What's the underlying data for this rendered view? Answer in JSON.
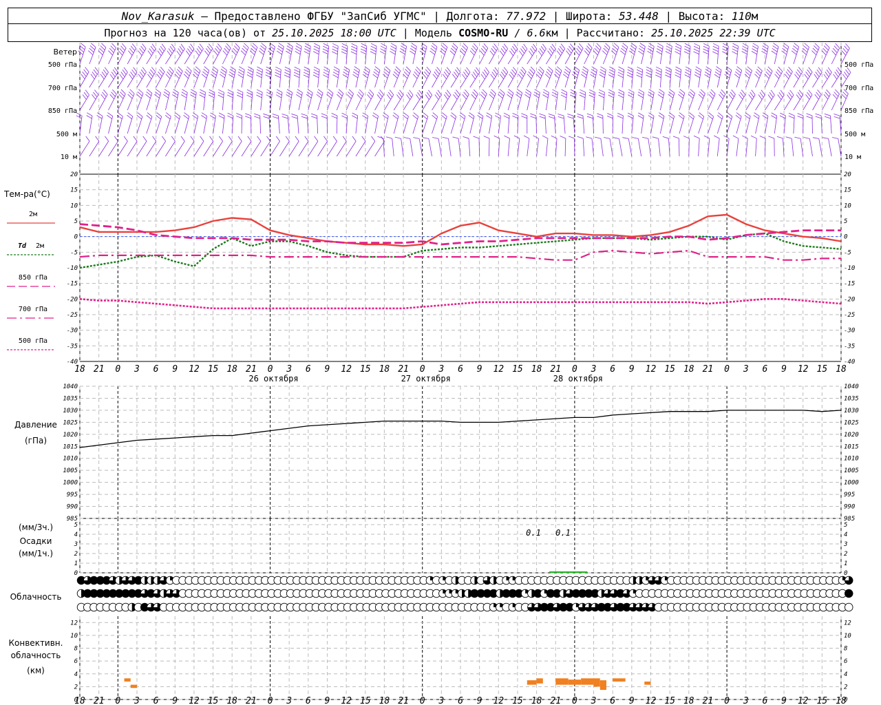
{
  "header": {
    "station": "Nov_Karasuk",
    "provider": " – Предоставлено ФГБУ \"ЗапСиб УГМС\" | Долгота: ",
    "lon": "77.972",
    "lat_label": " | Широта: ",
    "lat": "53.448",
    "alt_label": " | Высота: ",
    "alt": "110",
    "alt_unit": "м",
    "forecast_label": "Прогноз на 120 часа(ов) от ",
    "forecast_start": "25.10.2025 18:00 UTC",
    "model_label": " | Модель ",
    "model": "COSMO-RU",
    "res_sep": " / ",
    "res": "6.6",
    "res_unit": "км",
    "calc_label": " | Рассчитано: ",
    "calc_time": "25.10.2025 22:39 UTC"
  },
  "colors": {
    "t2m": "#e8413c",
    "td2m": "#1a7a1a",
    "t850": "#e0218a",
    "t700": "#e0218a",
    "t500": "#e0218a",
    "wind": "#8a2be2",
    "precip": "#22bb22",
    "conv": "#f08020",
    "pressure": "#000000"
  },
  "chart_data": [
    {
      "type": "wind_barbs",
      "panel_label": "Ветер",
      "levels": [
        "500 гПа",
        "700 гПа",
        "850 гПа",
        "500 м",
        "10 м"
      ],
      "level_speeds_approx_kt": [
        45,
        40,
        25,
        20,
        10
      ]
    },
    {
      "type": "line",
      "ylabel": "Тем-ра(°С)",
      "ylim": [
        -40,
        20
      ],
      "yticks": [
        20,
        15,
        10,
        5,
        0,
        -5,
        -10,
        -15,
        -20,
        -25,
        -30,
        -35,
        -40
      ],
      "x_hours_from_start": [
        0,
        3,
        6,
        9,
        12,
        15,
        18,
        21,
        24,
        27,
        30,
        33,
        36,
        39,
        42,
        45,
        48,
        51,
        54,
        57,
        60,
        63,
        66,
        69,
        72,
        75,
        78,
        81,
        84,
        87,
        90,
        93,
        96,
        99,
        102,
        105,
        108,
        111,
        114,
        117,
        120
      ],
      "series": [
        {
          "name": "2м",
          "style": "solid",
          "values": [
            3,
            1.5,
            1.5,
            1.5,
            1.5,
            2,
            3,
            5,
            6,
            5.5,
            2,
            0.5,
            -0.5,
            -1.5,
            -2,
            -2.5,
            -2.5,
            -3,
            -2.5,
            1,
            3.5,
            4.5,
            2,
            1,
            0,
            1,
            1,
            0.5,
            0.5,
            0,
            0.5,
            1.5,
            3.5,
            6.5,
            7,
            4,
            2,
            1,
            0,
            -0.5,
            -1.5
          ]
        },
        {
          "name": "Td 2м",
          "style": "dotted",
          "values": [
            -10,
            -9,
            -8,
            -6.5,
            -6,
            -8,
            -9.5,
            -4,
            -0.5,
            -3,
            -1.5,
            -1.5,
            -3,
            -5,
            -6,
            -6.5,
            -6.5,
            -6.5,
            -4.5,
            -4,
            -3.5,
            -3.5,
            -3,
            -2.5,
            -2,
            -1.5,
            -1,
            -0.5,
            -0.5,
            -0.5,
            -1,
            -0.5,
            0,
            0,
            -1,
            0.5,
            1,
            -1.5,
            -3,
            -3.5,
            -4
          ]
        },
        {
          "name": "850 гПа",
          "style": "dashed",
          "values": [
            4,
            3.5,
            3,
            2,
            0.5,
            0,
            -0.5,
            -0.5,
            -0.5,
            -1,
            -1,
            -1,
            -1.5,
            -1.5,
            -2,
            -2,
            -2,
            -2,
            -1.5,
            -2.5,
            -2,
            -1.5,
            -1.5,
            -1,
            -0.5,
            -0.5,
            -0.5,
            -0.5,
            -0.5,
            -0.5,
            -0.5,
            0,
            0,
            -1,
            -0.5,
            0.5,
            1,
            1.5,
            2,
            2,
            2
          ]
        },
        {
          "name": "700 гПа",
          "style": "dashdot",
          "values": [
            -6.5,
            -6,
            -6,
            -6,
            -6,
            -6,
            -6,
            -6,
            -6,
            -6,
            -6.5,
            -6.5,
            -6.5,
            -6.5,
            -6.5,
            -6.5,
            -6.5,
            -6.5,
            -6.5,
            -6.5,
            -6.5,
            -6.5,
            -6.5,
            -6.5,
            -7,
            -7.5,
            -7.5,
            -5,
            -4.5,
            -5,
            -5.5,
            -5,
            -4.5,
            -6.5,
            -6.5,
            -6.5,
            -6.5,
            -7.5,
            -7.5,
            -7,
            -7
          ]
        },
        {
          "name": "500 гПа",
          "style": "dotted",
          "values": [
            -20,
            -20.5,
            -20.5,
            -21,
            -21.5,
            -22,
            -22.5,
            -23,
            -23,
            -23,
            -23,
            -23,
            -23,
            -23,
            -23,
            -23,
            -23,
            -23,
            -22.5,
            -22,
            -21.5,
            -21,
            -21,
            -21,
            -21,
            -21,
            -21,
            -21,
            -21,
            -21,
            -21,
            -21,
            -21,
            -21.5,
            -21,
            -20.5,
            -20,
            -20,
            -20.5,
            -21,
            -21.5
          ]
        }
      ]
    },
    {
      "type": "line",
      "ylabel": "Давление",
      "yunit": "(гПа)",
      "ylim": [
        985,
        1040
      ],
      "yticks": [
        1040,
        1035,
        1030,
        1025,
        1020,
        1015,
        1010,
        1005,
        1000,
        995,
        990,
        985
      ],
      "x_hours_from_start": [
        0,
        3,
        6,
        9,
        12,
        15,
        18,
        21,
        24,
        27,
        30,
        33,
        36,
        39,
        42,
        45,
        48,
        51,
        54,
        57,
        60,
        63,
        66,
        69,
        72,
        75,
        78,
        81,
        84,
        87,
        90,
        93,
        96,
        99,
        102,
        105,
        108,
        111,
        114,
        117,
        120
      ],
      "series": [
        {
          "name": "Давление",
          "values": [
            1014.5,
            1015.5,
            1016.5,
            1017.5,
            1018,
            1018.5,
            1019,
            1019.5,
            1019.5,
            1020.5,
            1021.5,
            1022.5,
            1023.5,
            1024,
            1024.5,
            1025,
            1025.5,
            1025.5,
            1025.5,
            1025.5,
            1025,
            1025,
            1025,
            1025.5,
            1026,
            1026.5,
            1027,
            1027,
            1028,
            1028.5,
            1029,
            1029.5,
            1029.5,
            1029.5,
            1030,
            1030,
            1030,
            1030,
            1030,
            1029.5,
            1030
          ]
        }
      ]
    },
    {
      "type": "bar",
      "ylabel": "Осадки",
      "yunit_top": "(мм/3ч.)",
      "yunit_bottom": "(мм/1ч.)",
      "ylim": [
        0,
        5
      ],
      "yticks": [
        5,
        4,
        3,
        2,
        1,
        0
      ],
      "annotations": [
        "0.1",
        "0.1"
      ],
      "bars": [
        {
          "hour": 75,
          "value": 0.1
        },
        {
          "hour": 77,
          "value": 0.15
        },
        {
          "hour": 79,
          "value": 0.1
        }
      ]
    },
    {
      "type": "cloud_cover",
      "ylabel": "Облачность",
      "rows": [
        [
          8,
          6,
          8,
          8,
          8,
          6,
          4,
          6,
          6,
          8,
          4,
          4,
          4,
          6,
          2,
          0,
          0,
          0,
          0,
          0,
          0,
          0,
          0,
          0,
          0,
          0,
          0,
          0,
          0,
          0,
          0,
          0,
          0,
          0,
          0,
          0,
          0,
          0,
          0,
          0,
          0,
          0,
          0,
          0,
          0,
          0,
          0,
          0,
          0,
          0,
          0,
          0,
          0,
          0,
          0,
          2,
          0,
          2,
          0,
          4,
          0,
          0,
          4,
          0,
          6,
          4,
          0,
          2,
          2,
          0,
          0,
          0,
          0,
          0,
          0,
          0,
          0,
          0,
          0,
          0,
          0,
          0,
          0,
          0,
          0,
          0,
          0,
          4,
          4,
          2,
          6,
          6,
          2,
          0,
          0,
          0,
          0,
          0,
          0,
          0,
          0,
          0,
          0,
          0,
          0,
          0,
          0,
          0,
          0,
          0,
          0,
          0,
          0,
          0,
          0,
          0,
          0,
          0,
          0,
          0,
          2,
          6
        ],
        [
          4,
          8,
          8,
          8,
          8,
          8,
          8,
          8,
          8,
          8,
          6,
          8,
          6,
          4,
          6,
          6,
          0,
          0,
          0,
          0,
          0,
          0,
          0,
          0,
          0,
          0,
          0,
          0,
          0,
          0,
          0,
          0,
          0,
          0,
          0,
          0,
          0,
          0,
          0,
          0,
          0,
          0,
          0,
          0,
          0,
          0,
          0,
          0,
          0,
          0,
          0,
          0,
          0,
          0,
          0,
          0,
          0,
          2,
          2,
          2,
          4,
          4,
          8,
          8,
          8,
          8,
          4,
          8,
          8,
          8,
          2,
          4,
          8,
          2,
          8,
          8,
          4,
          6,
          8,
          8,
          8,
          8,
          4,
          6,
          6,
          8,
          6,
          2,
          0,
          0,
          0,
          0,
          0,
          0,
          0,
          0,
          0,
          0,
          0,
          0,
          0,
          0,
          0,
          0,
          0,
          0,
          0,
          0,
          0,
          0,
          0,
          0,
          0,
          0,
          0,
          0,
          0,
          0,
          0,
          0,
          0,
          8
        ],
        [
          0,
          0,
          0,
          0,
          0,
          0,
          0,
          0,
          4,
          0,
          8,
          6,
          6,
          0,
          0,
          0,
          0,
          0,
          0,
          0,
          0,
          0,
          0,
          0,
          0,
          0,
          0,
          0,
          0,
          0,
          0,
          0,
          0,
          0,
          0,
          0,
          0,
          0,
          0,
          0,
          0,
          0,
          0,
          0,
          0,
          0,
          0,
          0,
          0,
          0,
          0,
          0,
          0,
          0,
          0,
          0,
          0,
          0,
          0,
          0,
          0,
          0,
          0,
          0,
          0,
          2,
          2,
          0,
          2,
          0,
          0,
          6,
          6,
          8,
          8,
          6,
          8,
          8,
          2,
          6,
          6,
          6,
          8,
          8,
          6,
          8,
          8,
          6,
          6,
          6,
          6,
          0,
          0,
          0,
          0,
          0,
          0,
          0,
          0,
          0,
          0,
          0,
          0,
          0,
          0,
          0,
          0,
          0,
          0,
          0,
          0,
          0,
          0,
          0,
          0,
          0,
          0,
          0,
          0,
          0,
          0,
          0
        ]
      ]
    },
    {
      "type": "bar",
      "ylabel": "Конвективн. облачность",
      "yunit": "(км)",
      "ylim": [
        0,
        13
      ],
      "yticks": [
        12,
        10,
        8,
        6,
        4,
        2,
        0
      ],
      "segments": [
        {
          "hour_from": 7,
          "hour_to": 8,
          "bottom_km": 2.8,
          "top_km": 3.3
        },
        {
          "hour_from": 8,
          "hour_to": 9,
          "bottom_km": 1.8,
          "top_km": 2.3
        },
        {
          "hour_from": 70.5,
          "hour_to": 72,
          "bottom_km": 2.3,
          "top_km": 3
        },
        {
          "hour_from": 72,
          "hour_to": 73,
          "bottom_km": 2.5,
          "top_km": 3.3
        },
        {
          "hour_from": 75,
          "hour_to": 77,
          "bottom_km": 2.3,
          "top_km": 3.3
        },
        {
          "hour_from": 77,
          "hour_to": 79,
          "bottom_km": 2.3,
          "top_km": 3.1
        },
        {
          "hour_from": 79,
          "hour_to": 81,
          "bottom_km": 2.3,
          "top_km": 3.3
        },
        {
          "hour_from": 81,
          "hour_to": 82,
          "bottom_km": 2,
          "top_km": 3.3
        },
        {
          "hour_from": 82,
          "hour_to": 83,
          "bottom_km": 1.5,
          "top_km": 3
        },
        {
          "hour_from": 84,
          "hour_to": 86,
          "bottom_km": 2.8,
          "top_km": 3.3
        },
        {
          "hour_from": 89,
          "hour_to": 90,
          "bottom_km": 2.3,
          "top_km": 2.8
        }
      ]
    }
  ],
  "time_axis": {
    "hour_labels": [
      "18",
      "21",
      "0",
      "3",
      "6",
      "9",
      "12",
      "15",
      "18",
      "21",
      "0",
      "3",
      "6",
      "9",
      "12",
      "15",
      "18",
      "21",
      "0",
      "3",
      "6",
      "9",
      "12",
      "15",
      "18",
      "21",
      "0",
      "3",
      "6",
      "9",
      "12",
      "15",
      "18",
      "21",
      "0",
      "3",
      "6",
      "9",
      "12",
      "15",
      "18",
      "21",
      "0"
    ],
    "date_labels": [
      "26 октября",
      "27 октября",
      "28 октября"
    ]
  },
  "legend": {
    "temp_title": "Тем-ра(°С)",
    "t2m": "2м",
    "td_prefix": "Td",
    "td_level": "2м",
    "t850": "850 гПа",
    "t700": "700 гПа",
    "t500": "500 гПа"
  }
}
